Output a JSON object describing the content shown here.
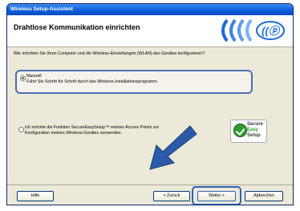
{
  "window": {
    "title": "Wireless Setup-Assistent"
  },
  "header": {
    "title": "Drahtlose Kommunikation einrichten"
  },
  "question": "Wie möchten Sie Ihren Computer und die Wireless-Einstellungen (WLAN) des Gerätes konfigurieren?",
  "options": [
    {
      "title": "Manuell",
      "text": "Führt Sie Schritt für Schritt durch das Wireless-Installationsprogramm.",
      "selected": true
    },
    {
      "text": "Ich möchte die Funktion SecureEasySetup™ meines Access Points zur Konfiguration meines Wireless-Gerätes verwenden.",
      "selected": false
    }
  ],
  "secure_easy_setup_logo": {
    "line1": "Secure",
    "line2": "Easy",
    "line3": "Setup"
  },
  "buttons": {
    "help": "Hilfe",
    "back": "< Zurück",
    "next": "Weiter >",
    "cancel": "Abbrechen"
  },
  "colors": {
    "title_bar": "#0a5bd8",
    "highlight": "#2f63b5",
    "arrow": "#2b5ba8",
    "logo_green": "#2e9d2e"
  },
  "icons": {
    "header_logo": "wireless-waves-icon",
    "pointer": "arrow-icon"
  }
}
